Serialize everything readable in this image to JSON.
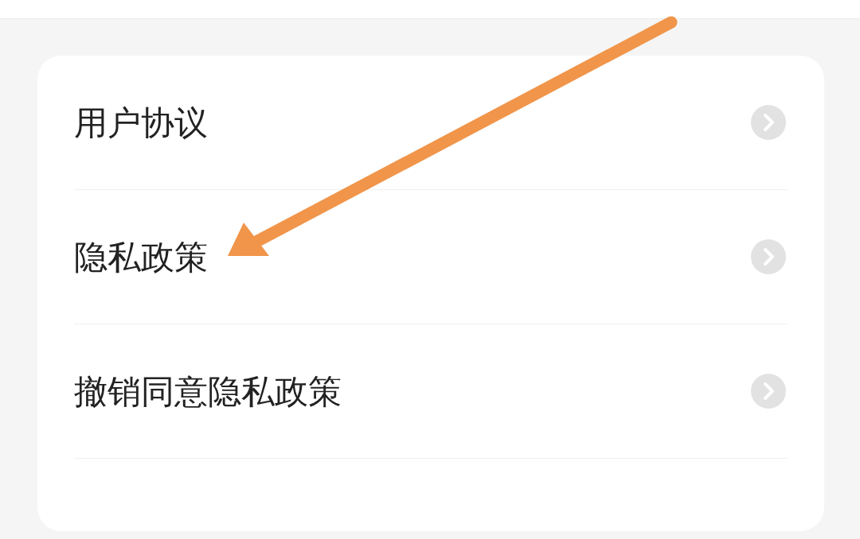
{
  "menu": [
    {
      "label": "用户协议"
    },
    {
      "label": "隐私政策"
    },
    {
      "label": "撤销同意隐私政策"
    }
  ]
}
